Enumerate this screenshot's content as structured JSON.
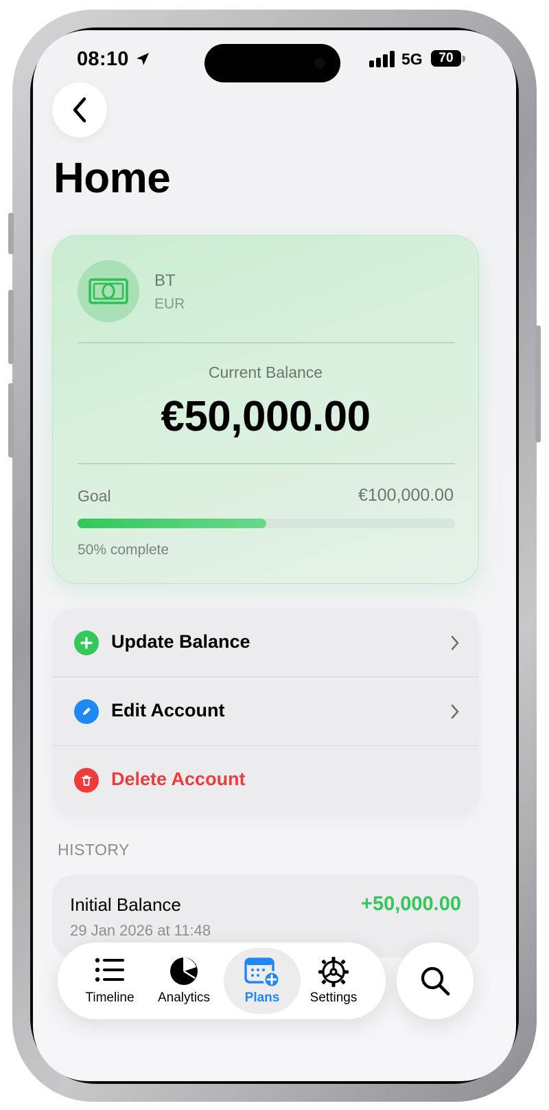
{
  "status_bar": {
    "time": "08:10",
    "network": "5G",
    "battery": "70"
  },
  "header": {
    "title": "Home"
  },
  "account_card": {
    "name": "BT",
    "currency": "EUR",
    "balance_label": "Current Balance",
    "balance": "€50,000.00",
    "goal_label": "Goal",
    "goal": "€100,000.00",
    "progress_fraction": 0.5,
    "progress_text": "50% complete",
    "icon": "banknote-icon"
  },
  "actions": [
    {
      "label": "Update Balance",
      "icon": "plus-icon",
      "color": "#34c759"
    },
    {
      "label": "Edit Account",
      "icon": "pencil-icon",
      "color": "#1e88f5"
    },
    {
      "label": "Delete Account",
      "icon": "trash-icon",
      "color": "#ef3b3b"
    }
  ],
  "history": {
    "heading": "HISTORY",
    "items": [
      {
        "title": "Initial Balance",
        "date": "29 Jan 2026 at 11:48",
        "amount": "+50,000.00"
      }
    ]
  },
  "tab_bar": {
    "tabs": [
      {
        "label": "Timeline",
        "icon": "list-icon"
      },
      {
        "label": "Analytics",
        "icon": "pie-chart-icon"
      },
      {
        "label": "Plans",
        "icon": "calendar-plus-icon",
        "active": true
      },
      {
        "label": "Settings",
        "icon": "gear-icon"
      }
    ],
    "search_icon": "search-icon"
  },
  "colors": {
    "accent_blue": "#1e88f5",
    "positive_green": "#34c759",
    "danger_red": "#ef3b3b"
  }
}
